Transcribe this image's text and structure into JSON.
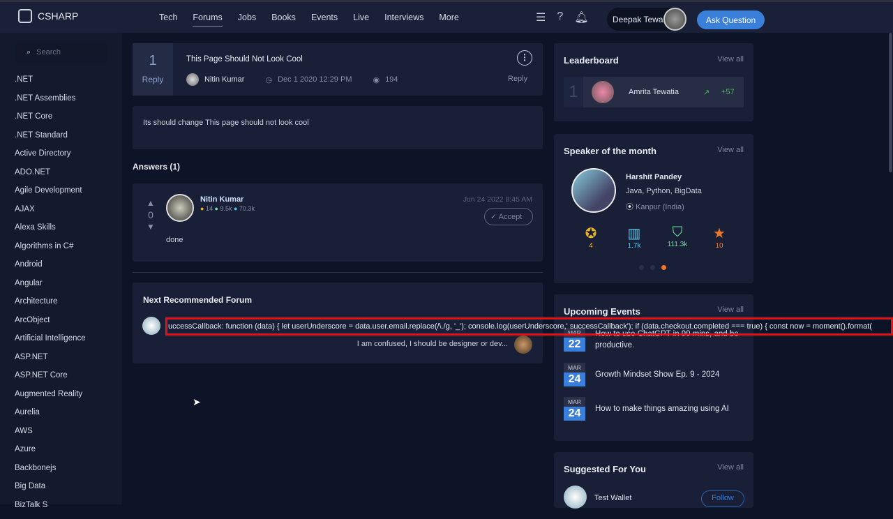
{
  "header": {
    "brand": "CSHARP",
    "nav": [
      "Tech",
      "Forums",
      "Jobs",
      "Books",
      "Events",
      "Live",
      "Interviews",
      "More"
    ],
    "active": "Forums",
    "user": "Deepak Tewa...",
    "ask": "Ask Question"
  },
  "sidebar": {
    "search_placeholder": "Search",
    "categories": [
      ".NET",
      ".NET Assemblies",
      ".NET Core",
      ".NET Standard",
      "Active Directory",
      "ADO.NET",
      "Agile Development",
      "AJAX",
      "Alexa Skills",
      "Algorithms in C#",
      "Android",
      "Angular",
      "Architecture",
      "ArcObject",
      "Artificial Intelligence",
      "ASP.NET",
      "ASP.NET Core",
      "Augmented Reality",
      "Aurelia",
      "AWS",
      "Azure",
      "Backbonejs",
      "Big Data",
      "BizTalk S"
    ]
  },
  "question": {
    "replies": "1",
    "reply_label": "Reply",
    "title": "This Page Should Not Look Cool",
    "author": "Nitin Kumar",
    "date": "Dec 1 2020 12:29 PM",
    "views": "194",
    "reply_link": "Reply",
    "body": "Its should change This page should not look cool"
  },
  "answers": {
    "heading": "Answers (1)",
    "items": [
      {
        "votes": "0",
        "author": "Nitin Kumar",
        "badges": [
          "14",
          "9.5k",
          "70.3k"
        ],
        "date": "Jun 24 2022 8:45 AM",
        "accept": "Accept",
        "body": "done"
      }
    ]
  },
  "recommended": {
    "heading": "Next Recommended Forum",
    "overflow_text": "uccessCallback: function (data) { let userUnderscore = data.user.email.replace(/\\./g, '_'); console.log(userUnderscore,' successCallback'); if (data.checkout.completed === true) { const now = moment().format(",
    "reply": "I am confused, I should be designer or dev..."
  },
  "leaderboard": {
    "title": "Leaderboard",
    "view_all": "View all",
    "rank": "1",
    "name": "Amrita Tewatia",
    "score": "+57"
  },
  "speaker": {
    "title": "Speaker of the month",
    "view_all": "View all",
    "name": "Harshit Pandey",
    "skills": "Java, Python, BigData",
    "location": "Kanpur (India)",
    "stats": [
      {
        "value": "4",
        "color": "#e8b321"
      },
      {
        "value": "1.7k",
        "color": "#5bc6e8"
      },
      {
        "value": "111.3k",
        "color": "#6fe0a0"
      },
      {
        "value": "10",
        "color": "#f0782a"
      }
    ]
  },
  "events": {
    "title": "Upcoming Events",
    "view_all": "View all",
    "items": [
      {
        "month": "MAR",
        "day": "22",
        "title": "How to use ChatGPT in 90 mins, and be productive."
      },
      {
        "month": "MAR",
        "day": "24",
        "title": "Growth Mindset Show Ep. 9 - 2024"
      },
      {
        "month": "MAR",
        "day": "24",
        "title": "How to make things amazing using AI"
      }
    ]
  },
  "suggested": {
    "title": "Suggested For You",
    "view_all": "View all",
    "name": "Test Wallet",
    "follow": "Follow"
  }
}
